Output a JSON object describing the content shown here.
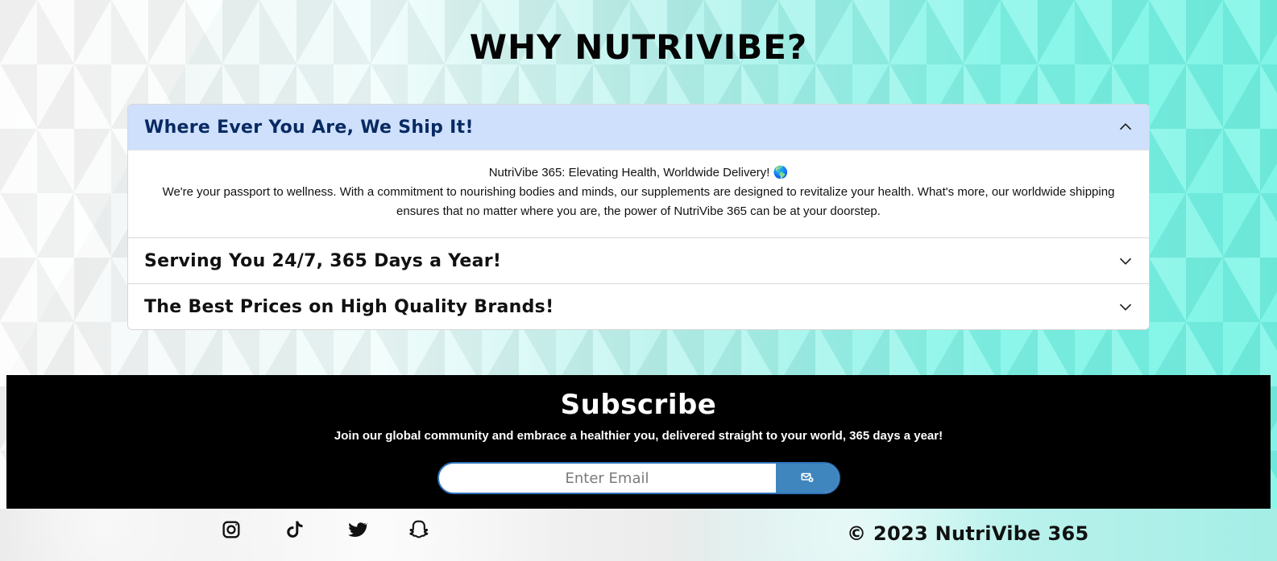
{
  "why": {
    "title": "WHY NUTRIVIBE?"
  },
  "faq": {
    "items": [
      {
        "title": "Where Ever You Are, We Ship It!",
        "lead": "NutriVibe 365: Elevating Health, Worldwide Delivery! 🌎",
        "body": "We're your passport to wellness. With a commitment to nourishing bodies and minds, our supplements are designed to revitalize your health. What's more, our worldwide shipping ensures that no matter where you are, the power of NutriVibe 365 can be at your doorstep."
      },
      {
        "title": "Serving You 24/7, 365 Days a Year!"
      },
      {
        "title": "The Best Prices on High Quality Brands!"
      }
    ]
  },
  "subscribe": {
    "title": "Subscribe",
    "description": "Join our global community and embrace a healthier you, delivered straight to your world, 365 days a year!",
    "placeholder": "Enter Email",
    "submit_icon": "mail-send-icon",
    "accent_color": "#3f86bf"
  },
  "footer": {
    "copyright": "© 2023 NutriVibe 365",
    "social_icons": [
      "instagram-icon",
      "tiktok-icon",
      "twitter-icon",
      "snapchat-icon"
    ]
  },
  "colors": {
    "faq_open_header": "#cfe0fd",
    "faq_open_text": "#082a62",
    "subscribe_background": "#000000"
  }
}
